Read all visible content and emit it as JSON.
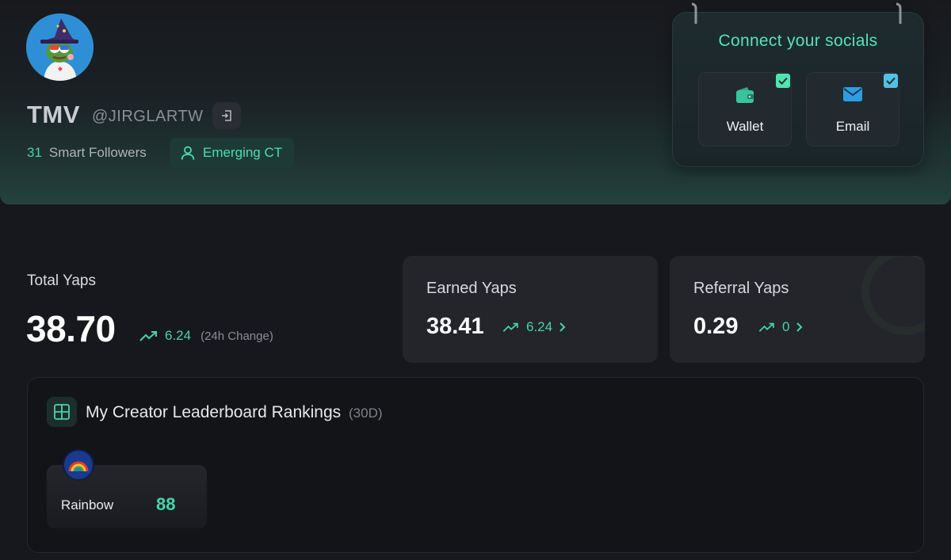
{
  "profile": {
    "display_name": "TMV",
    "handle": "@JIRGLARTW",
    "followers_count": "31",
    "followers_label": "Smart Followers",
    "badge_label": "Emerging CT",
    "avatar_icon": "pepe-wizard-avatar"
  },
  "socials": {
    "title": "Connect your socials",
    "items": [
      {
        "label": "Wallet",
        "icon": "wallet-icon",
        "connected": true
      },
      {
        "label": "Email",
        "icon": "email-icon",
        "connected": true
      }
    ]
  },
  "stats": {
    "total": {
      "label": "Total Yaps",
      "value": "38.70",
      "change": "6.24",
      "change_note": "(24h Change)"
    },
    "earned": {
      "label": "Earned Yaps",
      "value": "38.41",
      "change": "6.24"
    },
    "referral": {
      "label": "Referral Yaps",
      "value": "0.29",
      "change": "0"
    }
  },
  "rankings": {
    "title": "My Creator Leaderboard Rankings",
    "period": "(30D)",
    "items": [
      {
        "name": "Rainbow",
        "score": "88",
        "icon": "rainbow-icon"
      }
    ]
  },
  "colors": {
    "accent": "#3fd8a8",
    "background": "#17181d",
    "card": "#23252b"
  }
}
